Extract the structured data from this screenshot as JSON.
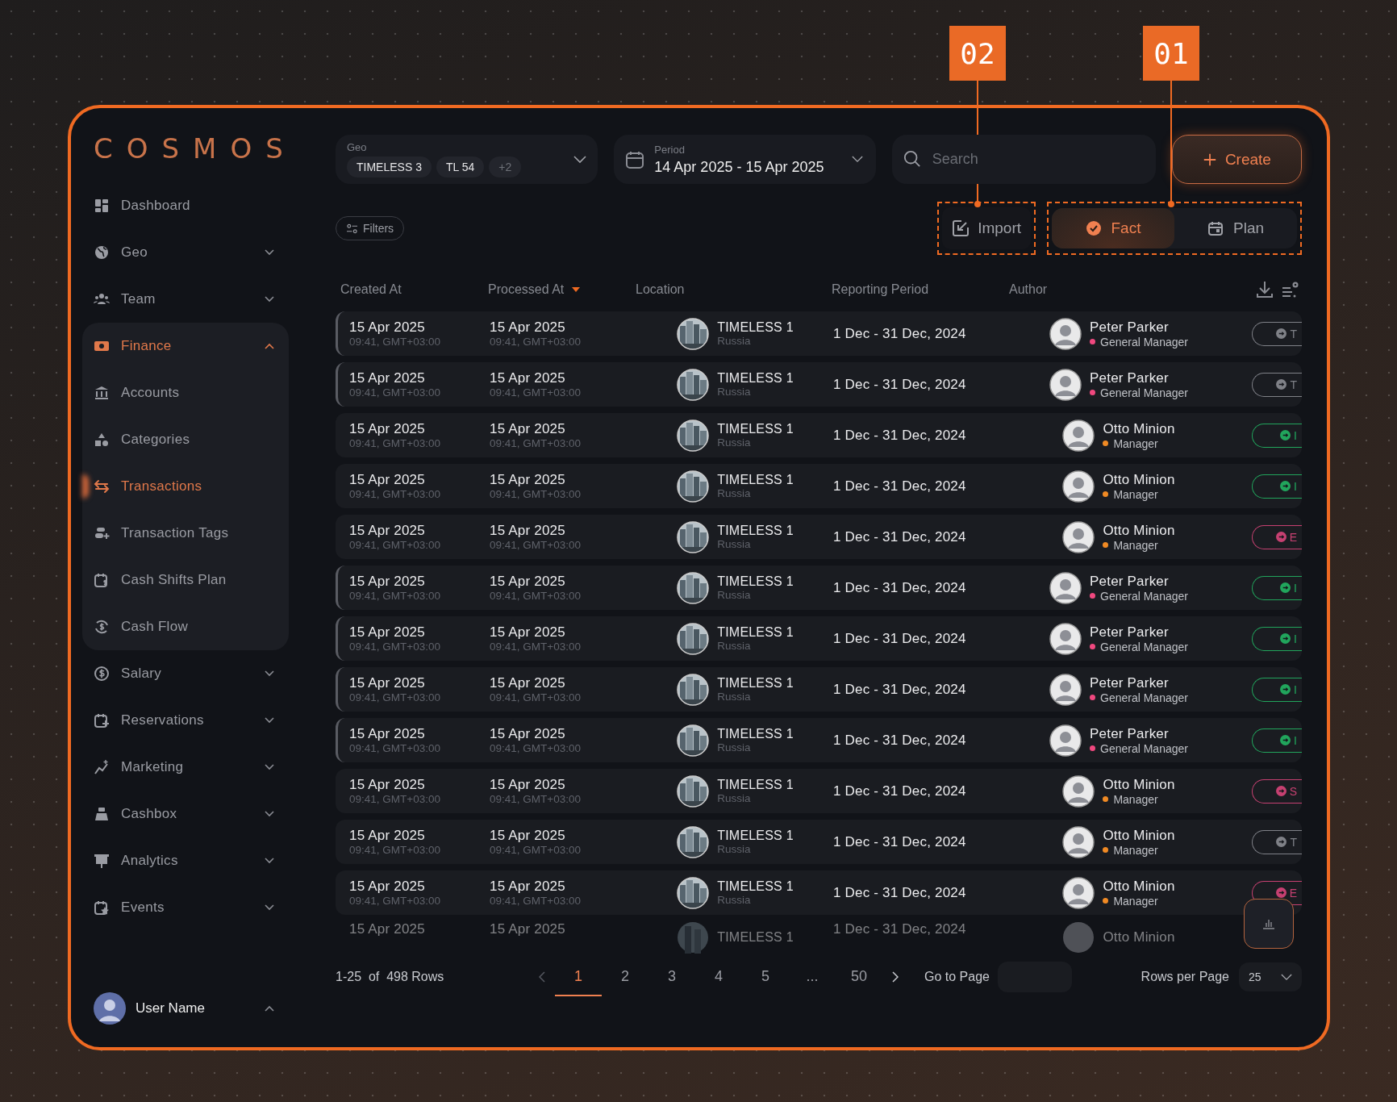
{
  "callouts": [
    {
      "label": "02"
    },
    {
      "label": "01"
    }
  ],
  "logo": "COSMOS",
  "sidebar": {
    "items": [
      {
        "label": "Dashboard",
        "kind": "link",
        "selected": false
      },
      {
        "label": "Geo",
        "kind": "group",
        "expanded": false,
        "selected": false
      },
      {
        "label": "Team",
        "kind": "group",
        "expanded": false,
        "selected": false
      },
      {
        "label": "Finance",
        "kind": "group",
        "expanded": true,
        "selected": true,
        "children": [
          {
            "label": "Accounts",
            "selected": false
          },
          {
            "label": "Categories",
            "selected": false
          },
          {
            "label": "Transactions",
            "selected": true
          },
          {
            "label": "Transaction Tags",
            "selected": false
          },
          {
            "label": "Cash Shifts Plan",
            "selected": false
          },
          {
            "label": "Cash Flow",
            "selected": false
          }
        ]
      },
      {
        "label": "Salary",
        "kind": "group",
        "expanded": false,
        "selected": false
      },
      {
        "label": "Reservations",
        "kind": "group",
        "expanded": false,
        "selected": false
      },
      {
        "label": "Marketing",
        "kind": "group",
        "expanded": false,
        "selected": false
      },
      {
        "label": "Cashbox",
        "kind": "group",
        "expanded": false,
        "selected": false
      },
      {
        "label": "Analytics",
        "kind": "group",
        "expanded": false,
        "selected": false
      },
      {
        "label": "Events",
        "kind": "group",
        "expanded": false,
        "selected": false
      }
    ],
    "user": {
      "name": "User Name",
      "expanded": true
    }
  },
  "geo_filter": {
    "label": "Geo",
    "chips": [
      "TIMELESS 3",
      "TL 54"
    ],
    "more": "+2"
  },
  "period_filter": {
    "label": "Period",
    "value": "14 Apr 2025 - 15 Apr 2025"
  },
  "search": {
    "placeholder": "Search"
  },
  "create_button": "Create",
  "filters_button": "Filters",
  "import_button": "Import",
  "mode_toggle": [
    {
      "label": "Fact",
      "selected": true
    },
    {
      "label": "Plan",
      "selected": false
    }
  ],
  "table": {
    "columns": [
      {
        "label": "Created At",
        "sorted": false
      },
      {
        "label": "Processed At",
        "sorted": true
      },
      {
        "label": "Location",
        "sorted": false
      },
      {
        "label": "Reporting Period",
        "sorted": false
      },
      {
        "label": "Author",
        "sorted": false
      }
    ],
    "rows": [
      {
        "highlighted": true,
        "created": {
          "date": "15 Apr 2025",
          "time": "09:41, GMT+03:00"
        },
        "processed": {
          "date": "15 Apr 2025",
          "time": "09:41, GMT+03:00"
        },
        "location": {
          "name": "TIMELESS 1",
          "country": "Russia"
        },
        "period": "1 Dec - 31 Dec, 2024",
        "author": {
          "name": "Peter Parker",
          "role": "General Manager",
          "color": "#f0487f"
        },
        "status": {
          "kind": "transfer",
          "label": "T"
        }
      },
      {
        "highlighted": true,
        "created": {
          "date": "15 Apr 2025",
          "time": "09:41, GMT+03:00"
        },
        "processed": {
          "date": "15 Apr 2025",
          "time": "09:41, GMT+03:00"
        },
        "location": {
          "name": "TIMELESS 1",
          "country": "Russia"
        },
        "period": "1 Dec - 31 Dec, 2024",
        "author": {
          "name": "Peter Parker",
          "role": "General Manager",
          "color": "#f0487f"
        },
        "status": {
          "kind": "transfer",
          "label": "T"
        }
      },
      {
        "highlighted": false,
        "created": {
          "date": "15 Apr 2025",
          "time": "09:41, GMT+03:00"
        },
        "processed": {
          "date": "15 Apr 2025",
          "time": "09:41, GMT+03:00"
        },
        "location": {
          "name": "TIMELESS 1",
          "country": "Russia"
        },
        "period": "1 Dec - 31 Dec, 2024",
        "author": {
          "name": "Otto Minion",
          "role": "Manager",
          "color": "#f08a24"
        },
        "status": {
          "kind": "income",
          "label": "I"
        }
      },
      {
        "highlighted": false,
        "created": {
          "date": "15 Apr 2025",
          "time": "09:41, GMT+03:00"
        },
        "processed": {
          "date": "15 Apr 2025",
          "time": "09:41, GMT+03:00"
        },
        "location": {
          "name": "TIMELESS 1",
          "country": "Russia"
        },
        "period": "1 Dec - 31 Dec, 2024",
        "author": {
          "name": "Otto Minion",
          "role": "Manager",
          "color": "#f08a24"
        },
        "status": {
          "kind": "income",
          "label": "I"
        }
      },
      {
        "highlighted": false,
        "created": {
          "date": "15 Apr 2025",
          "time": "09:41, GMT+03:00"
        },
        "processed": {
          "date": "15 Apr 2025",
          "time": "09:41, GMT+03:00"
        },
        "location": {
          "name": "TIMELESS 1",
          "country": "Russia"
        },
        "period": "1 Dec - 31 Dec, 2024",
        "author": {
          "name": "Otto Minion",
          "role": "Manager",
          "color": "#f08a24"
        },
        "status": {
          "kind": "expense",
          "label": "E"
        }
      },
      {
        "highlighted": true,
        "created": {
          "date": "15 Apr 2025",
          "time": "09:41, GMT+03:00"
        },
        "processed": {
          "date": "15 Apr 2025",
          "time": "09:41, GMT+03:00"
        },
        "location": {
          "name": "TIMELESS 1",
          "country": "Russia"
        },
        "period": "1 Dec - 31 Dec, 2024",
        "author": {
          "name": "Peter Parker",
          "role": "General Manager",
          "color": "#f0487f"
        },
        "status": {
          "kind": "income",
          "label": "I"
        }
      },
      {
        "highlighted": true,
        "created": {
          "date": "15 Apr 2025",
          "time": "09:41, GMT+03:00"
        },
        "processed": {
          "date": "15 Apr 2025",
          "time": "09:41, GMT+03:00"
        },
        "location": {
          "name": "TIMELESS 1",
          "country": "Russia"
        },
        "period": "1 Dec - 31 Dec, 2024",
        "author": {
          "name": "Peter Parker",
          "role": "General Manager",
          "color": "#f0487f"
        },
        "status": {
          "kind": "income",
          "label": "I"
        }
      },
      {
        "highlighted": true,
        "created": {
          "date": "15 Apr 2025",
          "time": "09:41, GMT+03:00"
        },
        "processed": {
          "date": "15 Apr 2025",
          "time": "09:41, GMT+03:00"
        },
        "location": {
          "name": "TIMELESS 1",
          "country": "Russia"
        },
        "period": "1 Dec - 31 Dec, 2024",
        "author": {
          "name": "Peter Parker",
          "role": "General Manager",
          "color": "#f0487f"
        },
        "status": {
          "kind": "income",
          "label": "I"
        }
      },
      {
        "highlighted": true,
        "created": {
          "date": "15 Apr 2025",
          "time": "09:41, GMT+03:00"
        },
        "processed": {
          "date": "15 Apr 2025",
          "time": "09:41, GMT+03:00"
        },
        "location": {
          "name": "TIMELESS 1",
          "country": "Russia"
        },
        "period": "1 Dec - 31 Dec, 2024",
        "author": {
          "name": "Peter Parker",
          "role": "General Manager",
          "color": "#f0487f"
        },
        "status": {
          "kind": "income",
          "label": "I"
        }
      },
      {
        "highlighted": false,
        "created": {
          "date": "15 Apr 2025",
          "time": "09:41, GMT+03:00"
        },
        "processed": {
          "date": "15 Apr 2025",
          "time": "09:41, GMT+03:00"
        },
        "location": {
          "name": "TIMELESS 1",
          "country": "Russia"
        },
        "period": "1 Dec - 31 Dec, 2024",
        "author": {
          "name": "Otto Minion",
          "role": "Manager",
          "color": "#f08a24"
        },
        "status": {
          "kind": "salary",
          "label": "S"
        }
      },
      {
        "highlighted": false,
        "created": {
          "date": "15 Apr 2025",
          "time": "09:41, GMT+03:00"
        },
        "processed": {
          "date": "15 Apr 2025",
          "time": "09:41, GMT+03:00"
        },
        "location": {
          "name": "TIMELESS 1",
          "country": "Russia"
        },
        "period": "1 Dec - 31 Dec, 2024",
        "author": {
          "name": "Otto Minion",
          "role": "Manager",
          "color": "#f08a24"
        },
        "status": {
          "kind": "transfer",
          "label": "T"
        }
      },
      {
        "highlighted": false,
        "created": {
          "date": "15 Apr 2025",
          "time": "09:41, GMT+03:00"
        },
        "processed": {
          "date": "15 Apr 2025",
          "time": "09:41, GMT+03:00"
        },
        "location": {
          "name": "TIMELESS 1",
          "country": "Russia"
        },
        "period": "1 Dec - 31 Dec, 2024",
        "author": {
          "name": "Otto Minion",
          "role": "Manager",
          "color": "#f08a24"
        },
        "status": {
          "kind": "expense",
          "label": "E"
        }
      }
    ],
    "partial_row": {
      "created": "15 Apr 2025",
      "processed": "15 Apr 2025",
      "location": "TIMELESS 1",
      "period": "1 Dec - 31 Dec, 2024",
      "author": "Otto Minion"
    }
  },
  "pagination": {
    "summary": "1-25  of  498 Rows",
    "pages": [
      {
        "label": "1",
        "selected": true
      },
      {
        "label": "2",
        "selected": false
      },
      {
        "label": "3",
        "selected": false
      },
      {
        "label": "4",
        "selected": false
      },
      {
        "label": "5",
        "selected": false
      },
      {
        "label": "...",
        "selected": false
      },
      {
        "label": "50",
        "selected": false
      }
    ],
    "go_to_label": "Go to Page",
    "rows_per_page_label": "Rows per Page",
    "rows_per_page": "25"
  }
}
